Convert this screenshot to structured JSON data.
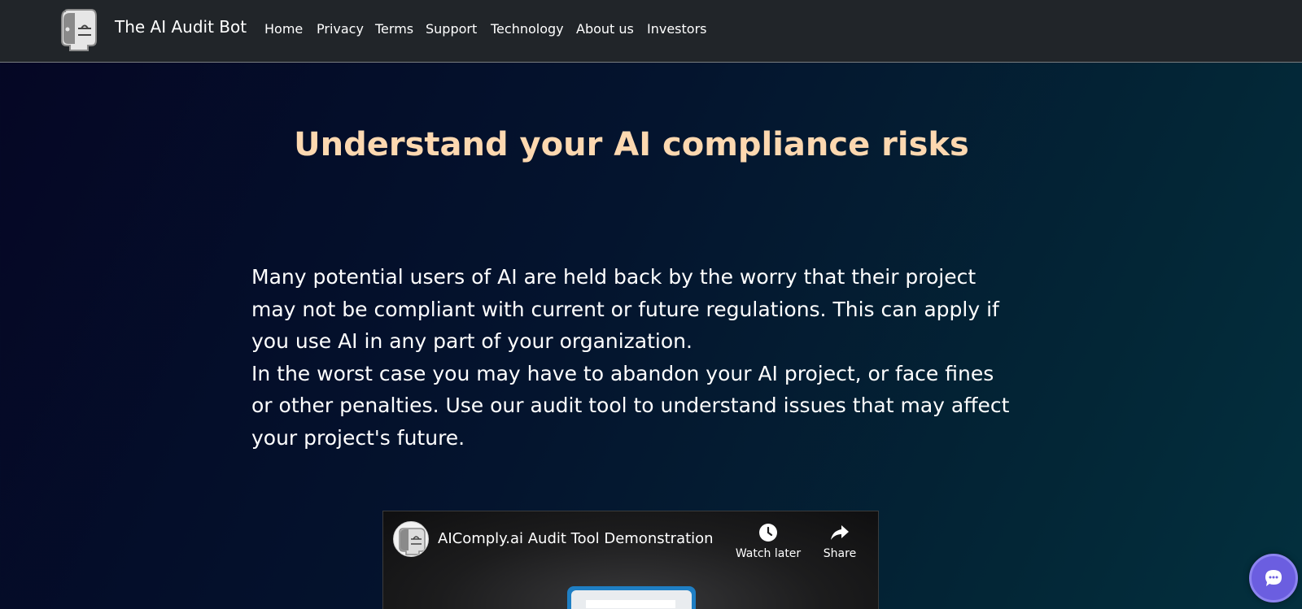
{
  "brand": {
    "name": "The AI Audit Bot",
    "logo_icon": "robot-scales-logo-icon"
  },
  "nav": {
    "items": [
      {
        "label": "Home"
      },
      {
        "label": "Privacy"
      },
      {
        "label": "Terms"
      },
      {
        "label": "Support"
      },
      {
        "label": "Technology"
      },
      {
        "label": "About us"
      },
      {
        "label": "Investors"
      }
    ]
  },
  "hero": {
    "title": "Understand your AI compliance risks"
  },
  "intro": {
    "paragraph1": "Many potential users of AI are held back by the worry that their project may not be compliant with current or future regulations. This can apply if you use AI in any part of your organization.",
    "paragraph2": "In the worst case you may have to abandon your AI project, or face fines or other penalties. Use our audit tool to understand issues that may affect your project's future."
  },
  "video": {
    "title": "AIComply.ai Audit Tool Demonstration",
    "watch_later_label": "Watch later",
    "share_label": "Share",
    "watch_later_icon": "clock-icon",
    "share_icon": "share-arrow-icon"
  },
  "chat": {
    "icon": "chat-bubble-icon"
  },
  "colors": {
    "navbar_bg": "#212529",
    "title_accent": "#fdd8b0",
    "chat_button": "#6b5ee0"
  }
}
